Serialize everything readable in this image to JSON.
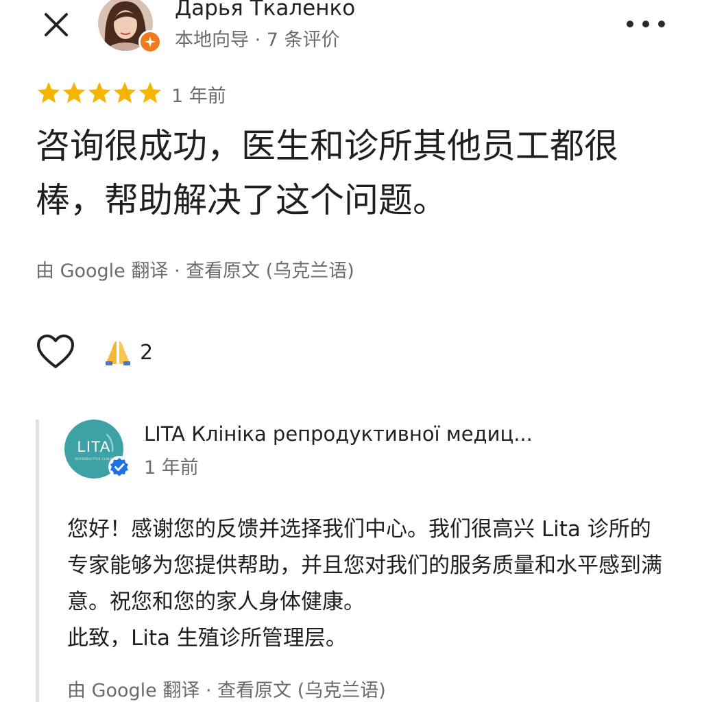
{
  "reviewer": {
    "name": "Дарья Ткаленко",
    "meta": "本地向导 · 7 条评价"
  },
  "review": {
    "rating": 5,
    "time": "1 年前",
    "text": "咨询很成功，医生和诊所其他员工都很棒，帮助解决了这个问题。",
    "translated_by": "由 Google 翻译 · ",
    "view_original": "查看原文 (乌克兰语)"
  },
  "reactions": {
    "emoji": "🙏",
    "count": "2"
  },
  "owner_reply": {
    "logo_text": "LITA",
    "logo_subtext": "REPRODUCTIVE CLINIC",
    "name": "LITA Клініка репродуктивної медиц...",
    "time": "1 年前",
    "line1": "您好！感谢您的反馈并选择我们中心。我们很高兴 Lita 诊所的专家能够为您提供帮助，并且您对我们的服务质量和水平感到满意。祝您和您的家人身体健康。",
    "line2": "此致，Lita 生殖诊所管理层。",
    "translated_by": "由 Google 翻译 · ",
    "view_original": "查看原文 (乌克兰语)"
  },
  "colors": {
    "star": "#f5b400",
    "guide_badge": "#ef7a1d",
    "logo_bg": "#3ea1a5",
    "verified": "#1a73e8"
  },
  "icons": [
    "close-icon",
    "more-icon",
    "star-icon",
    "heart-icon",
    "praying-hands-emoji",
    "verified-icon",
    "local-guide-badge-icon"
  ]
}
